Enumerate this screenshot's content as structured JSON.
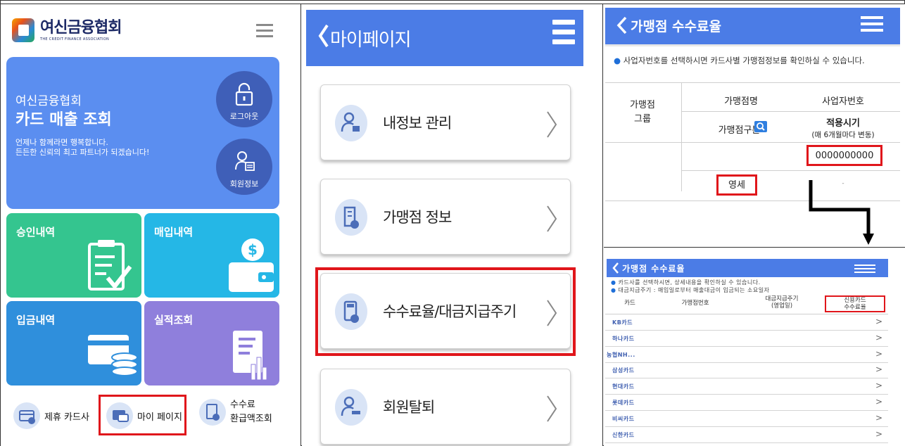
{
  "panel1": {
    "logo_ko": "여신금융협회",
    "logo_en": "THE CREDIT FINANCE ASSOCIATION",
    "hero_title1": "여신금융협회",
    "hero_title2": "카드 매출 조회",
    "hero_desc1": "언제나 함께라면 행복합니다.",
    "hero_desc2": "든든한 신뢰의 최고 파트너가 되겠습니다!",
    "logout_label": "로그아웃",
    "member_label": "회원정보",
    "tiles": {
      "approval": "승인내역",
      "purchase": "매입내역",
      "deposit": "입금내역",
      "performance": "실적조회"
    },
    "links": {
      "partner": "제휴 카드사",
      "mypage": "마이 페이지",
      "fee_line1": "수수료",
      "fee_line2": "환급액조회"
    },
    "colors": {
      "hero": "#5b8ef0",
      "tile_green": "#34c58f",
      "tile_cyan": "#25b7e6",
      "tile_blue": "#2f8fdc",
      "tile_purple": "#8f7fdc",
      "highlight": "#e0161b"
    }
  },
  "panel2": {
    "title": "마이페이지",
    "items": [
      {
        "label": "내정보 관리",
        "icon": "user-edit-icon"
      },
      {
        "label": "가맹점 정보",
        "icon": "building-icon"
      },
      {
        "label": "수수료율/대금지급주기",
        "icon": "calculator-icon"
      },
      {
        "label": "회원탈퇴",
        "icon": "user-remove-icon"
      }
    ]
  },
  "panel3": {
    "title": "가맹점 수수료율",
    "note": "사업자번호를 선택하시면 카드사별 가맹점정보를 확인하실 수 있습니다.",
    "col_group": "가맹점\n그룹",
    "col_name": "가맹점명",
    "col_bizno": "사업자번호",
    "col_type": "가맹점구분",
    "col_period": "적용시기",
    "col_period_sub": "(매 6개월마다 변동)",
    "bizno_value": "0000000000",
    "type_value": "영세",
    "period_value": "-"
  },
  "panel4": {
    "title": "가맹점 수수료율",
    "note1": "카드사를 선택하시면, 상세내용을 확인하실 수 있습니다.",
    "note2": "대금지급주기 : 매입일로부터 매출대금이 입금되는 소요일자",
    "h_card": "카드",
    "h_merchant_no": "가맹점번호",
    "h_cycle1": "대금지급주기",
    "h_cycle2": "(영업일)",
    "h_rate1": "신용카드",
    "h_rate2": "수수료율",
    "rows": [
      "KB카드",
      "하나카드",
      "농협NH...",
      "삼성카드",
      "현대카드",
      "롯데카드",
      "비씨카드",
      "신한카드"
    ],
    "arrow": ">"
  }
}
